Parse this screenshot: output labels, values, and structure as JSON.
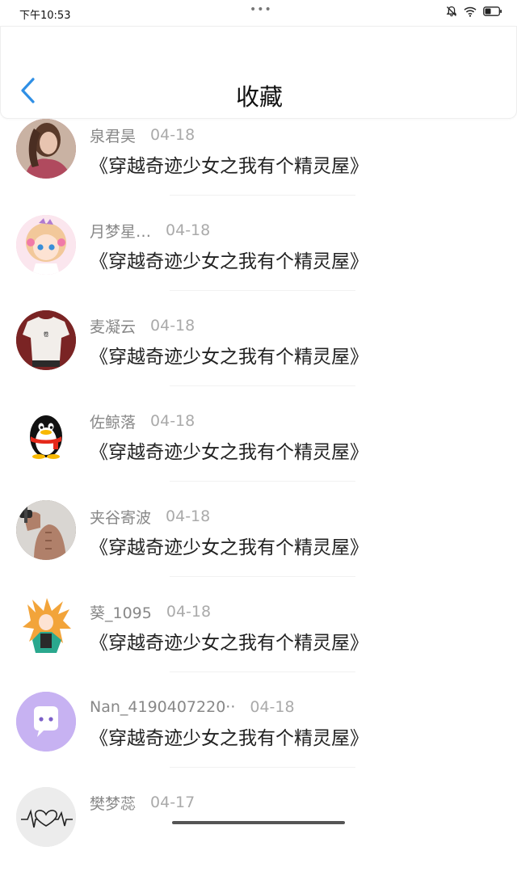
{
  "status": {
    "time": "下午10:53",
    "dots": "•••"
  },
  "header": {
    "title": "收藏"
  },
  "items": [
    {
      "user": "泉君昊",
      "date": "04-18",
      "book": "《穿越奇迹少女之我有个精灵屋》",
      "avatar": "photo-woman-icon",
      "avatar_color": "#b85a6a"
    },
    {
      "user": "月梦星…",
      "date": "04-18",
      "book": "《穿越奇迹少女之我有个精灵屋》",
      "avatar": "anime-girl-icon",
      "avatar_color": "#f4c8d8"
    },
    {
      "user": "麦凝云",
      "date": "04-18",
      "book": "《穿越奇迹少女之我有个精灵屋》",
      "avatar": "tshirt-photo-icon",
      "avatar_color": "#8a2c2c"
    },
    {
      "user": "佐鲸落",
      "date": "04-18",
      "book": "《穿越奇迹少女之我有个精灵屋》",
      "avatar": "qq-penguin-icon",
      "avatar_color": "#ffffff"
    },
    {
      "user": "夹谷寄波",
      "date": "04-18",
      "book": "《穿越奇迹少女之我有个精灵屋》",
      "avatar": "muscle-man-icon",
      "avatar_color": "#7a6a60"
    },
    {
      "user": "葵_1095",
      "date": "04-18",
      "book": "《穿越奇迹少女之我有个精灵屋》",
      "avatar": "anime-character-icon",
      "avatar_color": "#f2a43a"
    },
    {
      "user": "Nan_4190407220··",
      "date": "04-18",
      "book": "《穿越奇迹少女之我有个精灵屋》",
      "avatar": "chat-bubble-icon",
      "avatar_color": "#c7b2f2"
    },
    {
      "user": "樊梦蕊",
      "date": "04-17",
      "book": "",
      "avatar": "heartbeat-icon",
      "avatar_color": "#e6e6e6"
    }
  ]
}
